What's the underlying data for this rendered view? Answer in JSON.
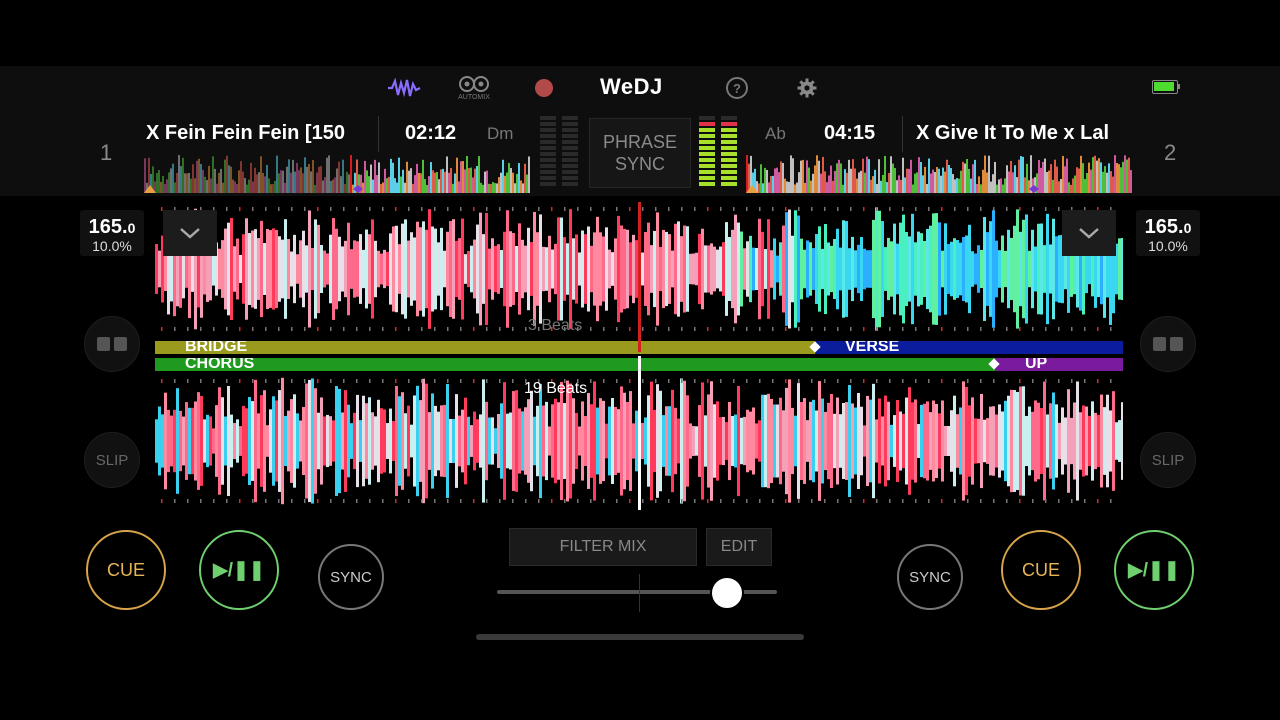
{
  "app": {
    "logo": "WeDJ",
    "automix_label": "AUTOMIX",
    "icons": {
      "waveform": "waveform-icon",
      "automix": "automix-icon",
      "record": "record-icon",
      "help": "help-icon",
      "settings": "gear-icon",
      "battery": "battery-icon"
    },
    "colors": {
      "accent": "#8a6cff",
      "record": "#b34a4a",
      "battery": "#4ddb2f"
    }
  },
  "center": {
    "phrase_sync_line1": "PHRASE",
    "phrase_sync_line2": "SYNC",
    "filter_mix_label": "FILTER MIX",
    "edit_label": "EDIT",
    "crossfader_value": 0.82
  },
  "deck1": {
    "number": "1",
    "title": "X Fein Fein Fein [150",
    "time": "02:12",
    "key": "Dm",
    "bpm_int": "165.",
    "bpm_dec": "0",
    "pitch": "10.0%",
    "cue_label": "CUE",
    "play_label": "▶/❚❚",
    "sync_label": "SYNC",
    "slip_label": "SLIP",
    "beats_label": "3 Beats",
    "meter_level": 0.0
  },
  "deck2": {
    "number": "2",
    "title": "X Give It To Me x Lal",
    "time": "04:15",
    "key": "Ab",
    "bpm_int": "165.",
    "bpm_dec": "0",
    "pitch": "10.0%",
    "cue_label": "CUE",
    "play_label": "▶/❚❚",
    "sync_label": "SYNC",
    "slip_label": "SLIP",
    "beats_label": "19 Beats",
    "meter_level": 0.9
  },
  "phrases": {
    "row1": [
      {
        "label": "BRIDGE",
        "color": "#9a9a1e"
      },
      {
        "label": "VERSE",
        "color": "#0b1c9c"
      }
    ],
    "row2": [
      {
        "label": "CHORUS",
        "color": "#1f9a1f"
      },
      {
        "label": "UP",
        "color": "#7a1a9c"
      }
    ]
  }
}
